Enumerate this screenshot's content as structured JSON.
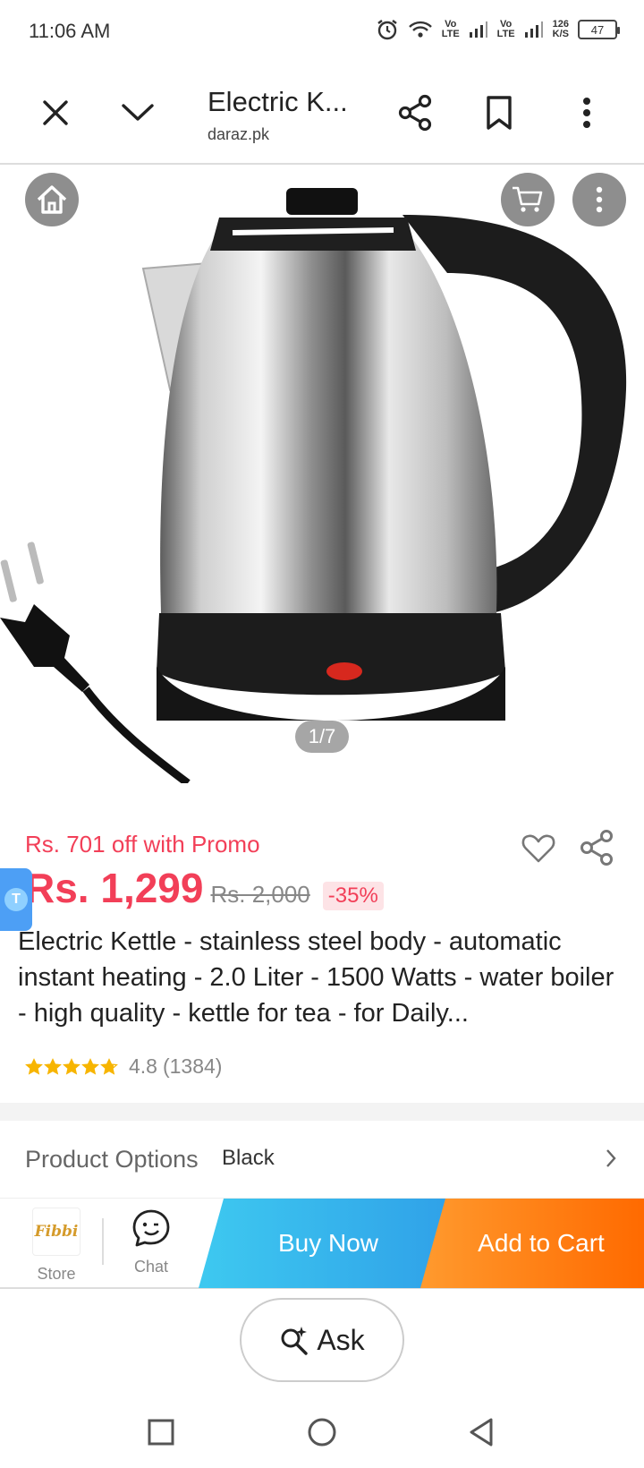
{
  "status_bar": {
    "time": "11:06 AM",
    "net1": "Vo\nLTE",
    "net2": "Vo\nLTE",
    "speed": "126\nK/S",
    "battery": "47"
  },
  "browser": {
    "title": "Electric K...",
    "domain": "daraz.pk"
  },
  "gallery": {
    "counter": "1/7"
  },
  "product": {
    "promo": "Rs. 701 off with Promo",
    "price": "Rs. 1,299",
    "old_price": "Rs. 2,000",
    "discount": "-35%",
    "title": "Electric Kettle - stainless steel body - automatic instant heating - 2.0 Liter - 1500 Watts - water boiler - high quality - kettle for tea - for Daily...",
    "rating": "4.8",
    "rating_count": "(1384)",
    "rating_stars": 4.8,
    "star_color": "#f7b500",
    "floating_badge": "T"
  },
  "options": {
    "label": "Product Options",
    "value": "Black"
  },
  "action_bar": {
    "store_logo_text": "Fibbi",
    "store_label": "Store",
    "chat_label": "Chat",
    "buy_now": "Buy Now",
    "add_to_cart": "Add to Cart"
  },
  "ask": {
    "label": "Ask"
  },
  "colors": {
    "accent": "#f23f58",
    "buy_now": "#2fa0e8",
    "add_to_cart": "#ff6a00"
  }
}
